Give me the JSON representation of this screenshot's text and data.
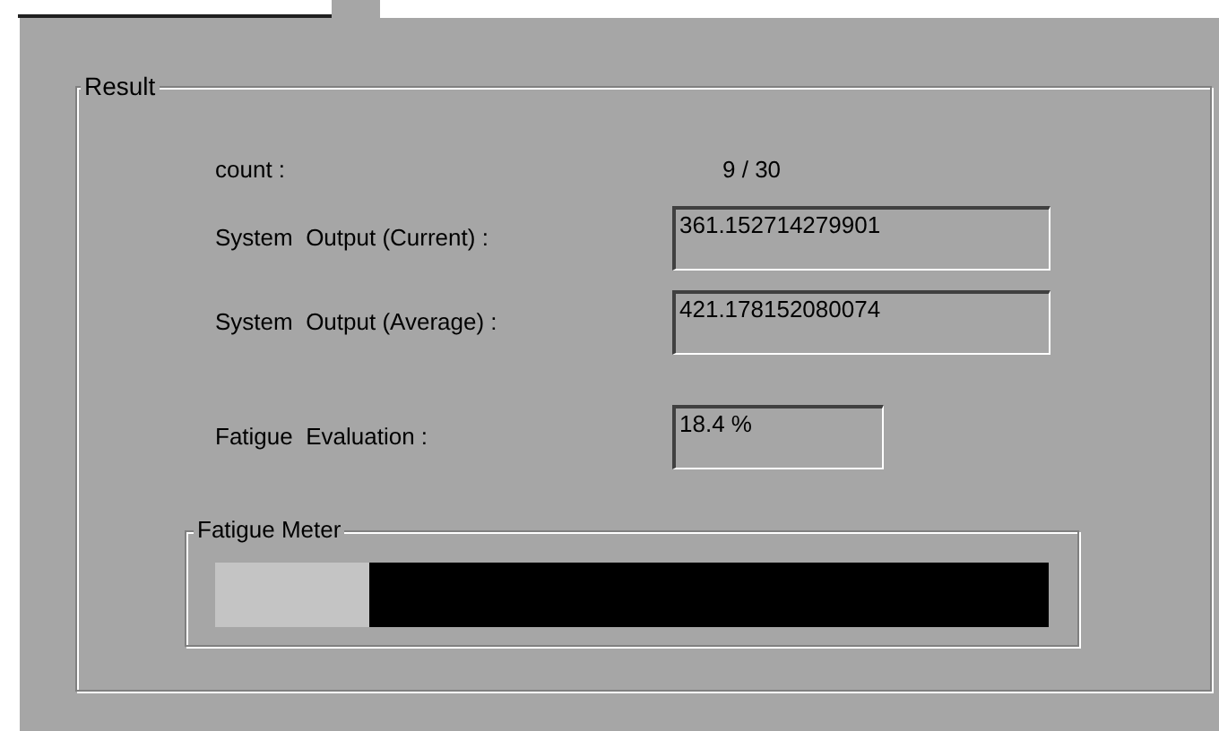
{
  "result_group": {
    "title": "Result",
    "count": {
      "label": "count :",
      "value": "9 / 30"
    },
    "fields": [
      {
        "label": "System  Output (Current) :",
        "value": "361.152714279901"
      },
      {
        "label": "System  Output (Average) :",
        "value": "421.178152080074"
      }
    ],
    "fatigue": {
      "label": "Fatigue  Evaluation :",
      "value": "18.4 %"
    },
    "meter": {
      "title": "Fatigue Meter",
      "level": 0.184
    }
  }
}
